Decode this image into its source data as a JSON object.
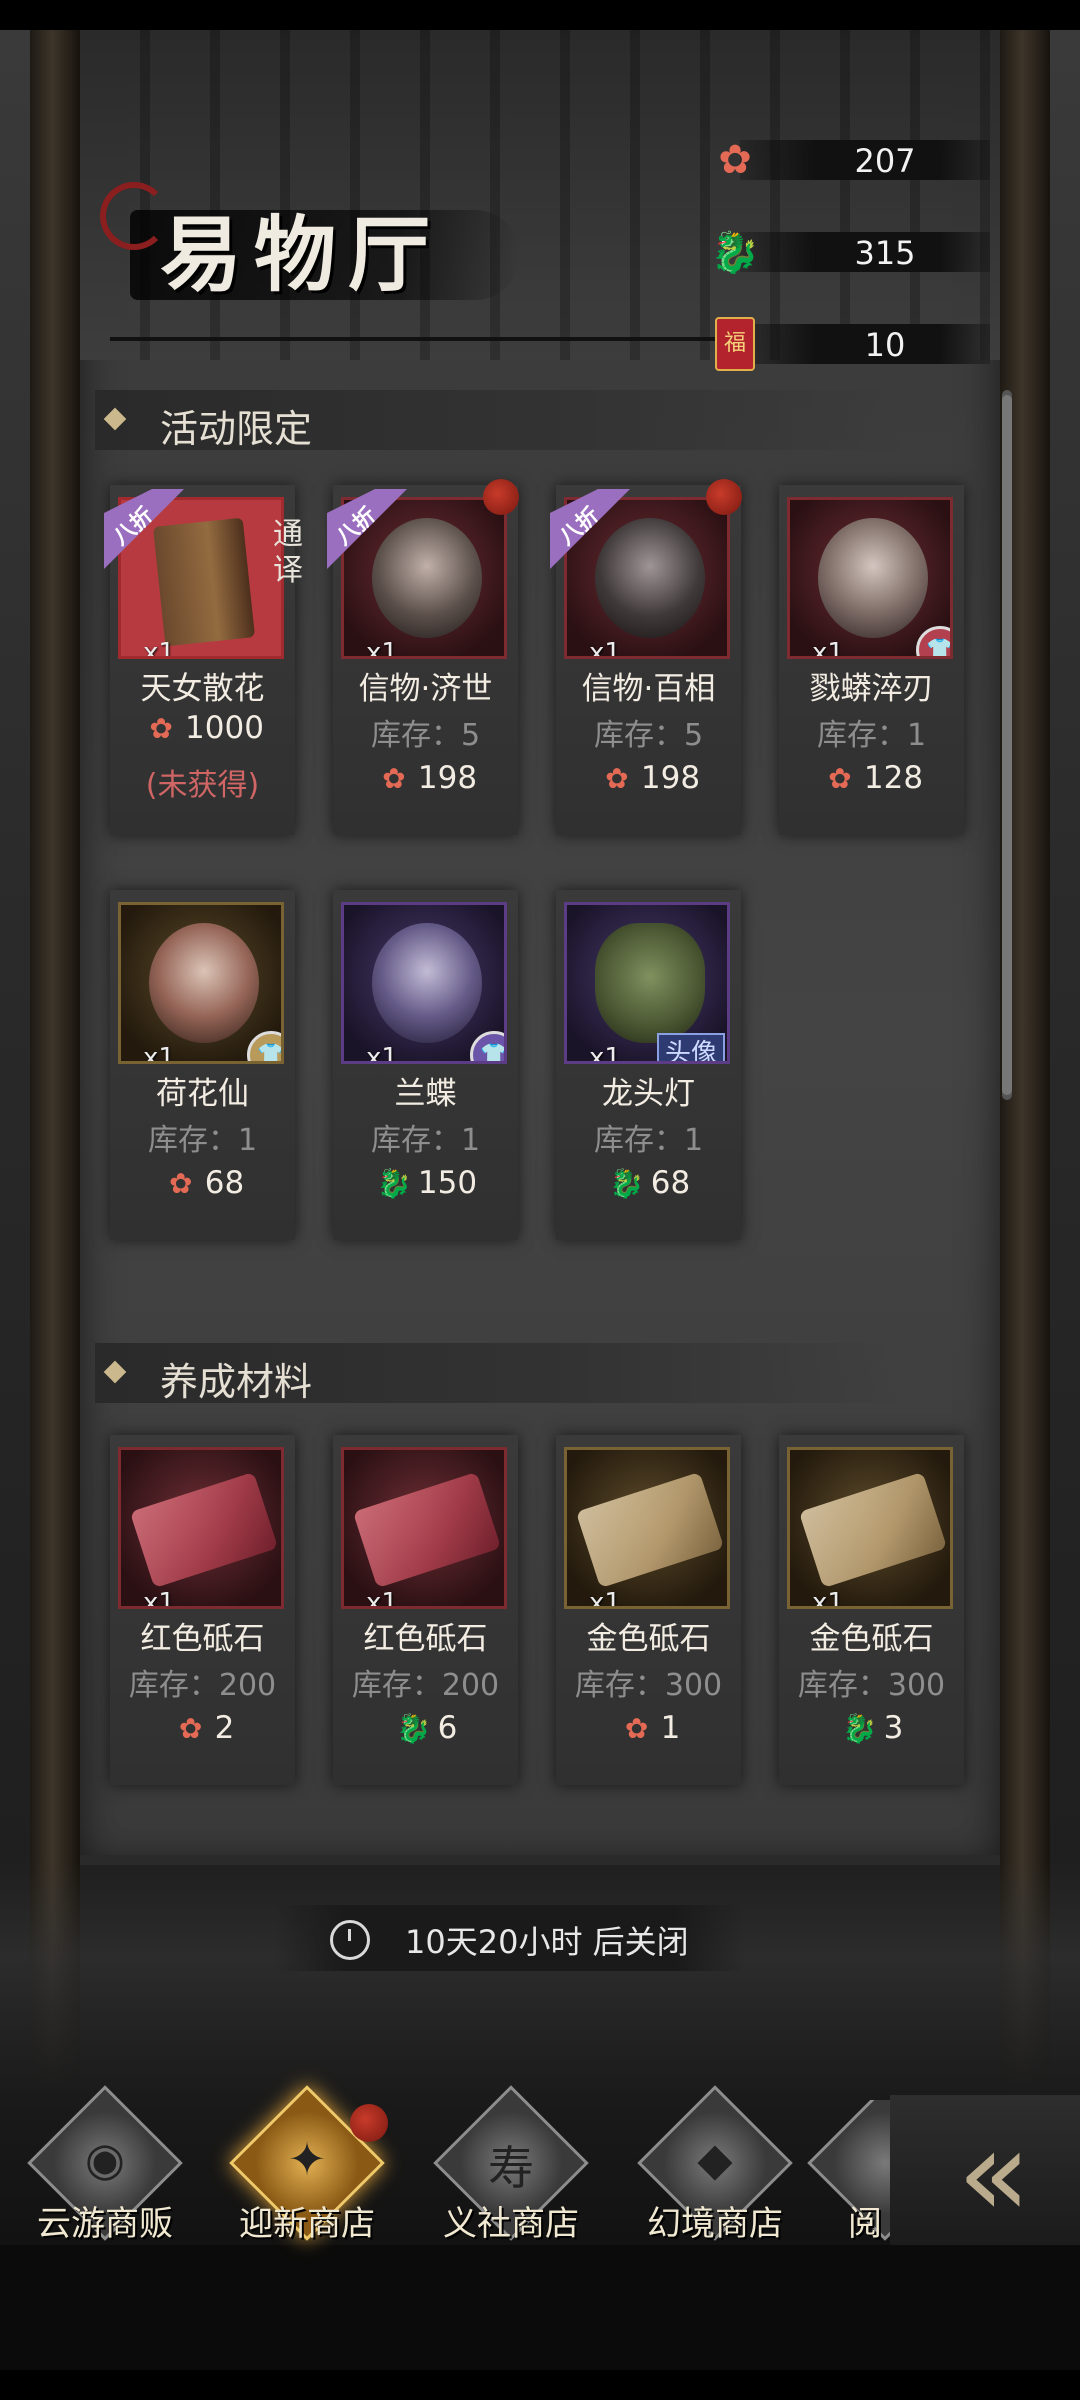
{
  "title": "易物厅",
  "currencies": [
    {
      "icon": "lotus-icon",
      "value": "207"
    },
    {
      "icon": "dragon-icon",
      "value": "315"
    },
    {
      "icon": "fortune-envelope-icon",
      "value": "10"
    }
  ],
  "sections": {
    "limited": {
      "title": "活动限定",
      "items": [
        {
          "name": "天女散花",
          "qty": "x1",
          "discount": "八折",
          "side_tag": "通译",
          "price": "1000",
          "currency": "lotus-icon",
          "status": "(未获得)"
        },
        {
          "name": "信物·济世",
          "qty": "x1",
          "discount": "八折",
          "stock": "库存：5",
          "price": "198",
          "currency": "lotus-icon"
        },
        {
          "name": "信物·百相",
          "qty": "x1",
          "discount": "八折",
          "stock": "库存：5",
          "price": "198",
          "currency": "lotus-icon"
        },
        {
          "name": "戮蟒淬刃",
          "qty": "x1",
          "stock": "库存：1",
          "price": "128",
          "currency": "lotus-icon"
        },
        {
          "name": "荷花仙",
          "qty": "x1",
          "stock": "库存：1",
          "price": "68",
          "currency": "lotus-icon"
        },
        {
          "name": "兰蝶",
          "qty": "x1",
          "stock": "库存：1",
          "price": "150",
          "currency": "dragon-icon"
        },
        {
          "name": "龙头灯",
          "qty": "x1",
          "tag": "头像",
          "stock": "库存：1",
          "price": "68",
          "currency": "dragon-icon"
        }
      ]
    },
    "materials": {
      "title": "养成材料",
      "items": [
        {
          "name": "红色砥石",
          "qty": "x1",
          "stock": "库存：200",
          "price": "2",
          "currency": "lotus-icon"
        },
        {
          "name": "红色砥石",
          "qty": "x1",
          "stock": "库存：200",
          "price": "6",
          "currency": "dragon-icon"
        },
        {
          "name": "金色砥石",
          "qty": "x1",
          "stock": "库存：300",
          "price": "1",
          "currency": "lotus-icon"
        },
        {
          "name": "金色砥石",
          "qty": "x1",
          "stock": "库存：300",
          "price": "3",
          "currency": "dragon-icon"
        }
      ]
    }
  },
  "timer": {
    "text": "10天20小时 后关闭"
  },
  "shop_tabs": [
    {
      "label": "云游商贩",
      "glyph": "◉"
    },
    {
      "label": "迎新商店",
      "glyph": "✦"
    },
    {
      "label": "义社商店",
      "glyph": "寿"
    },
    {
      "label": "幻境商店",
      "glyph": "◆"
    },
    {
      "label": "阅",
      "glyph": "◈"
    }
  ],
  "collapse": {
    "glyph": "«"
  }
}
